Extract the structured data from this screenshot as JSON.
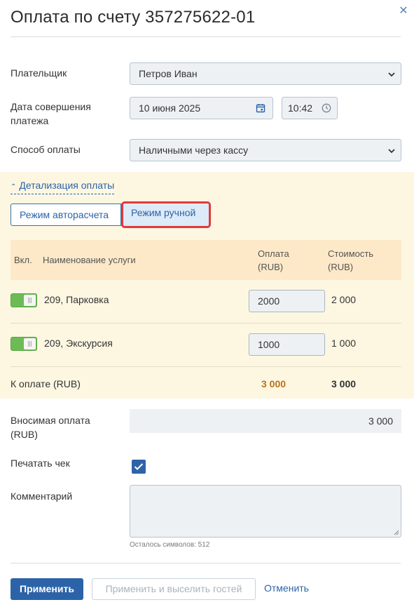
{
  "dialog": {
    "title": "Оплата по счету 357275622-01",
    "close_glyph": "✕"
  },
  "form": {
    "payer": {
      "label": "Плательщик",
      "value": "Петров Иван"
    },
    "payment_date": {
      "label": "Дата совершения платежа",
      "date_value": "10 июня 2025",
      "time_value": "10:42"
    },
    "payment_method": {
      "label": "Способ оплаты",
      "value": "Наличными через кассу"
    }
  },
  "details": {
    "toggle_label": "Детализация оплаты",
    "mode_auto_label": "Режим авторасчета",
    "mode_manual_label": "Режим ручной",
    "table": {
      "headers": {
        "enabled": "Вкл.",
        "service": "Наименование услуги",
        "payment_line1": "Оплата",
        "payment_line2": "(RUB)",
        "cost_line1": "Стоимость",
        "cost_line2": "(RUB)"
      },
      "rows": [
        {
          "enabled": true,
          "service": "209, Парковка",
          "payment": "2000",
          "cost": "2 000"
        },
        {
          "enabled": true,
          "service": "209, Экскурсия",
          "payment": "1000",
          "cost": "1 000"
        }
      ],
      "total": {
        "label": "К оплате (RUB)",
        "payment": "3 000",
        "cost": "3 000"
      }
    }
  },
  "deposit": {
    "label": "Вносимая оплата (RUB)",
    "value": "3 000"
  },
  "print_receipt": {
    "label": "Печатать чек",
    "checked": true
  },
  "comment": {
    "label": "Комментарий",
    "value": "",
    "hint": "Осталось символов: 512"
  },
  "actions": {
    "apply_label": "Применить",
    "apply_checkout_label": "Применить и выселить гостей",
    "cancel_label": "Отменить"
  },
  "colors": {
    "primary": "#2c63a8",
    "detail_bg": "#fdf7e2",
    "table_header_bg": "#fde9c8",
    "switch_on": "#6dbb55",
    "total_payment": "#b8721a",
    "highlight_border": "#e03a3a"
  }
}
